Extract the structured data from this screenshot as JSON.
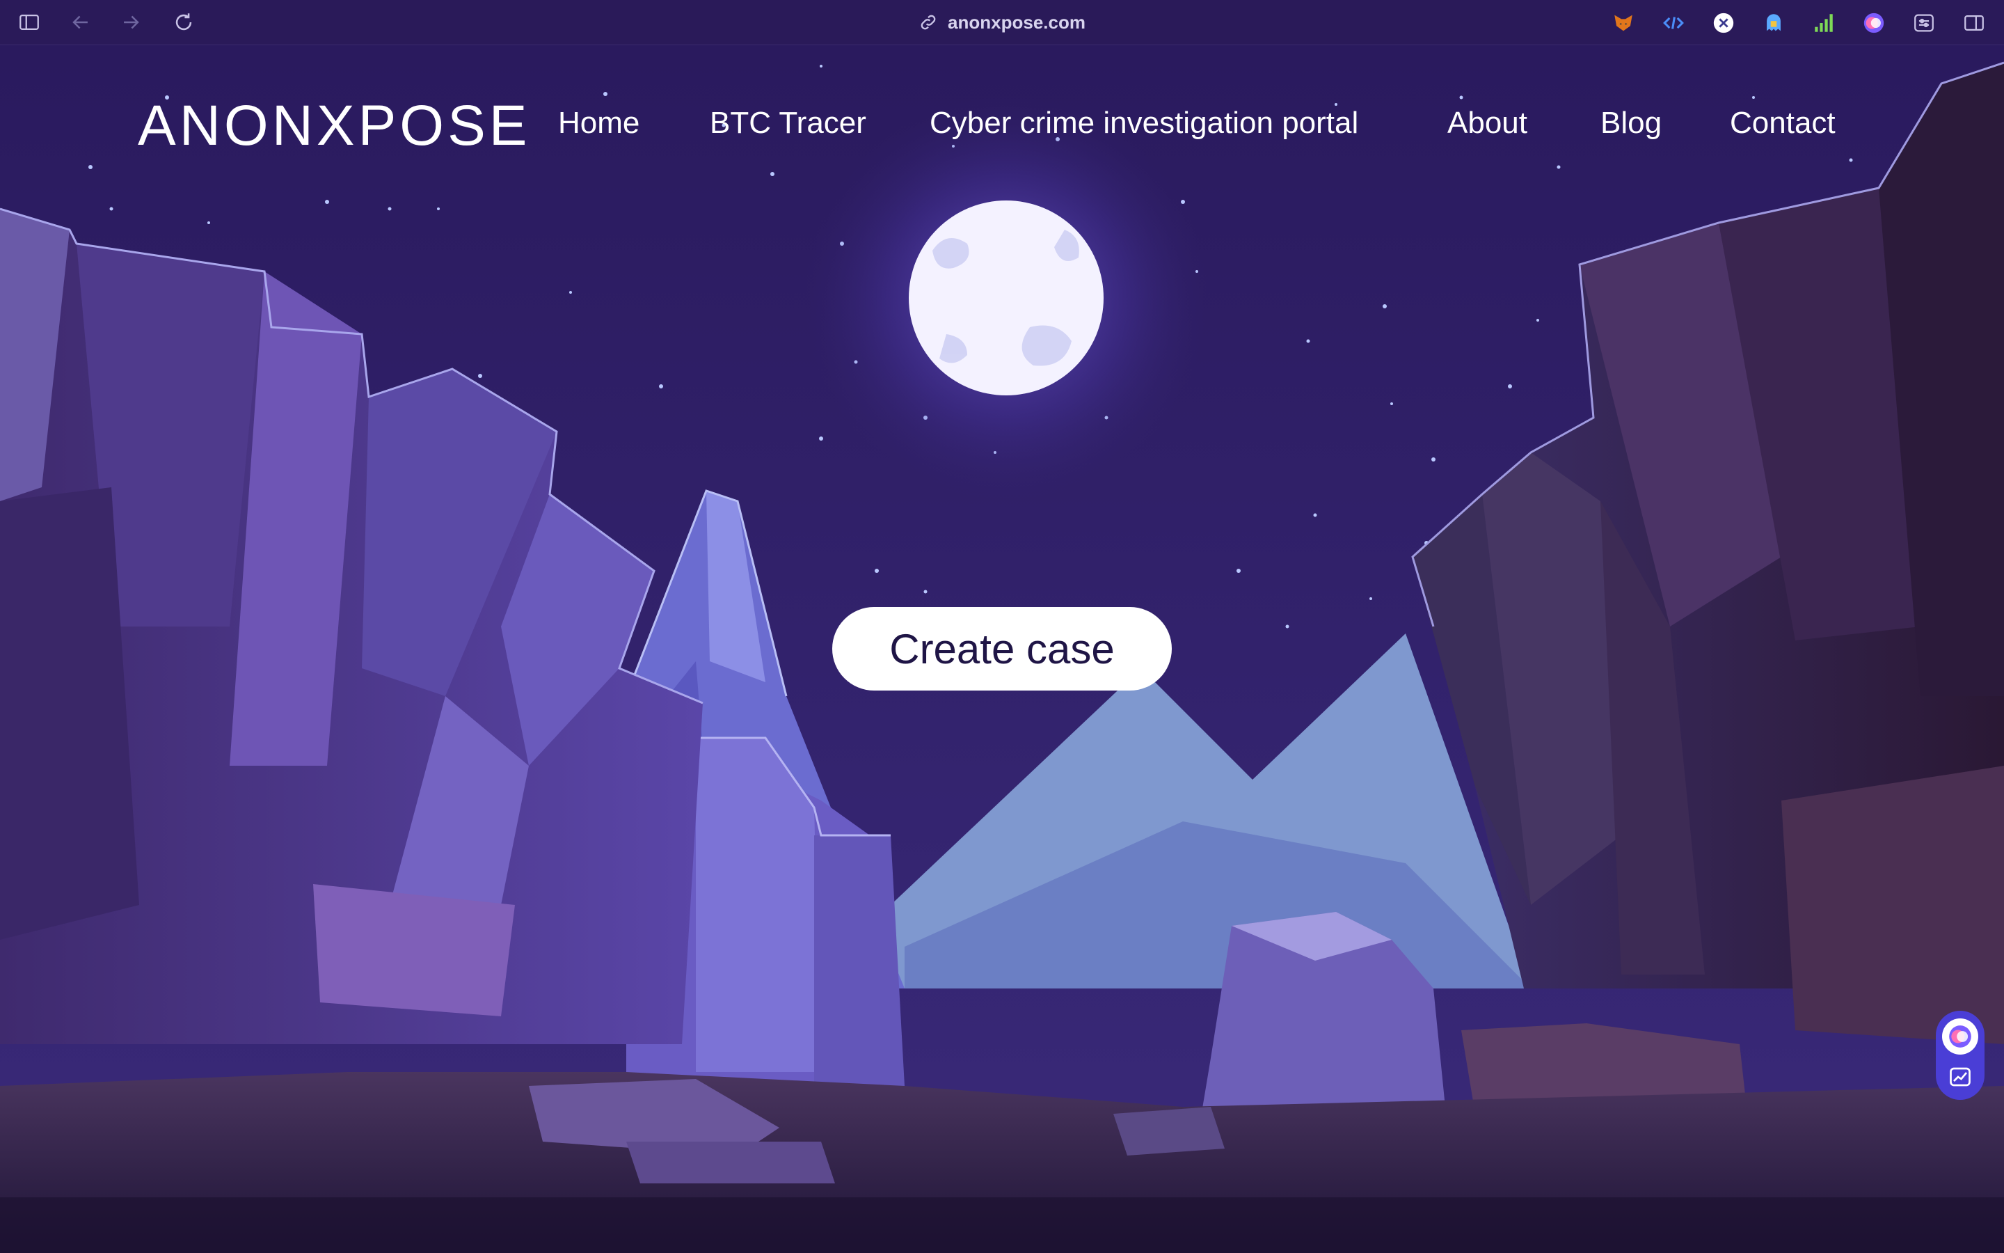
{
  "browser": {
    "url": "anonxpose.com"
  },
  "site": {
    "logo": "ANONXPOSE",
    "nav": [
      {
        "label": "Home"
      },
      {
        "label": "BTC Tracer"
      },
      {
        "label": "Cyber crime investigation portal"
      },
      {
        "label": "About"
      },
      {
        "label": "Blog"
      },
      {
        "label": "Contact"
      }
    ],
    "cta_label": "Create case"
  },
  "colors": {
    "sky": "#2d1d62",
    "accent": "#4a3ed6",
    "text": "#ffffff",
    "button_text": "#1f1546"
  },
  "icons": {
    "extensions": [
      "fox-extension-icon",
      "code-extension-icon",
      "shield-extension-icon",
      "ghost-extension-icon",
      "chart-extension-icon",
      "orb-extension-icon",
      "settings-extension-icon"
    ]
  }
}
